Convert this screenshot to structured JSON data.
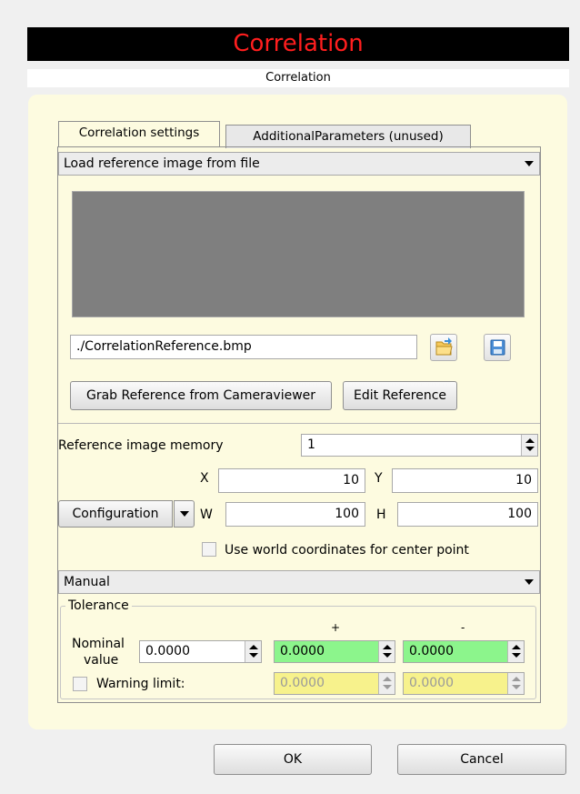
{
  "window": {
    "title": "Correlation",
    "subtitle": "Correlation"
  },
  "tabs": [
    {
      "label": "Correlation settings",
      "active": true
    },
    {
      "label": "AdditionalParameters (unused)",
      "active": false
    }
  ],
  "source_combo": {
    "value": "Load reference image from file"
  },
  "reference": {
    "file_path": "./CorrelationReference.bmp",
    "grab_button": "Grab Reference from Cameraviewer",
    "edit_button": "Edit Reference"
  },
  "memory": {
    "label": "Reference image memory",
    "value": "1"
  },
  "roi": {
    "x_label": "X",
    "x_value": "10",
    "y_label": "Y",
    "y_value": "10",
    "w_label": "W",
    "w_value": "100",
    "h_label": "H",
    "h_value": "100",
    "config_button": "Configuration",
    "world_coords_label": "Use world coordinates for center point",
    "world_coords_checked": false
  },
  "mode_combo": {
    "value": "Manual"
  },
  "tolerance": {
    "title": "Tolerance",
    "plus_header": "+",
    "minus_header": "-",
    "nominal_label_1": "Nominal",
    "nominal_label_2": "value",
    "nominal_value": "0.0000",
    "plus_value": "0.0000",
    "minus_value": "0.0000",
    "warning_label": "Warning limit:",
    "warning_checked": false,
    "warning_plus": "0.0000",
    "warning_minus": "0.0000"
  },
  "footer": {
    "ok": "OK",
    "cancel": "Cancel"
  },
  "colors": {
    "title_bg": "#000000",
    "title_text": "#ff1e1e",
    "panel_bg": "#fdfbe0",
    "image_bg": "#7f7f7f",
    "tolerance_green": "#8cf58c",
    "warning_yellow": "#f7f28c"
  },
  "icons": [
    "folder-open-icon",
    "save-icon",
    "dropdown-arrow-icon",
    "spin-up-down-icon"
  ]
}
